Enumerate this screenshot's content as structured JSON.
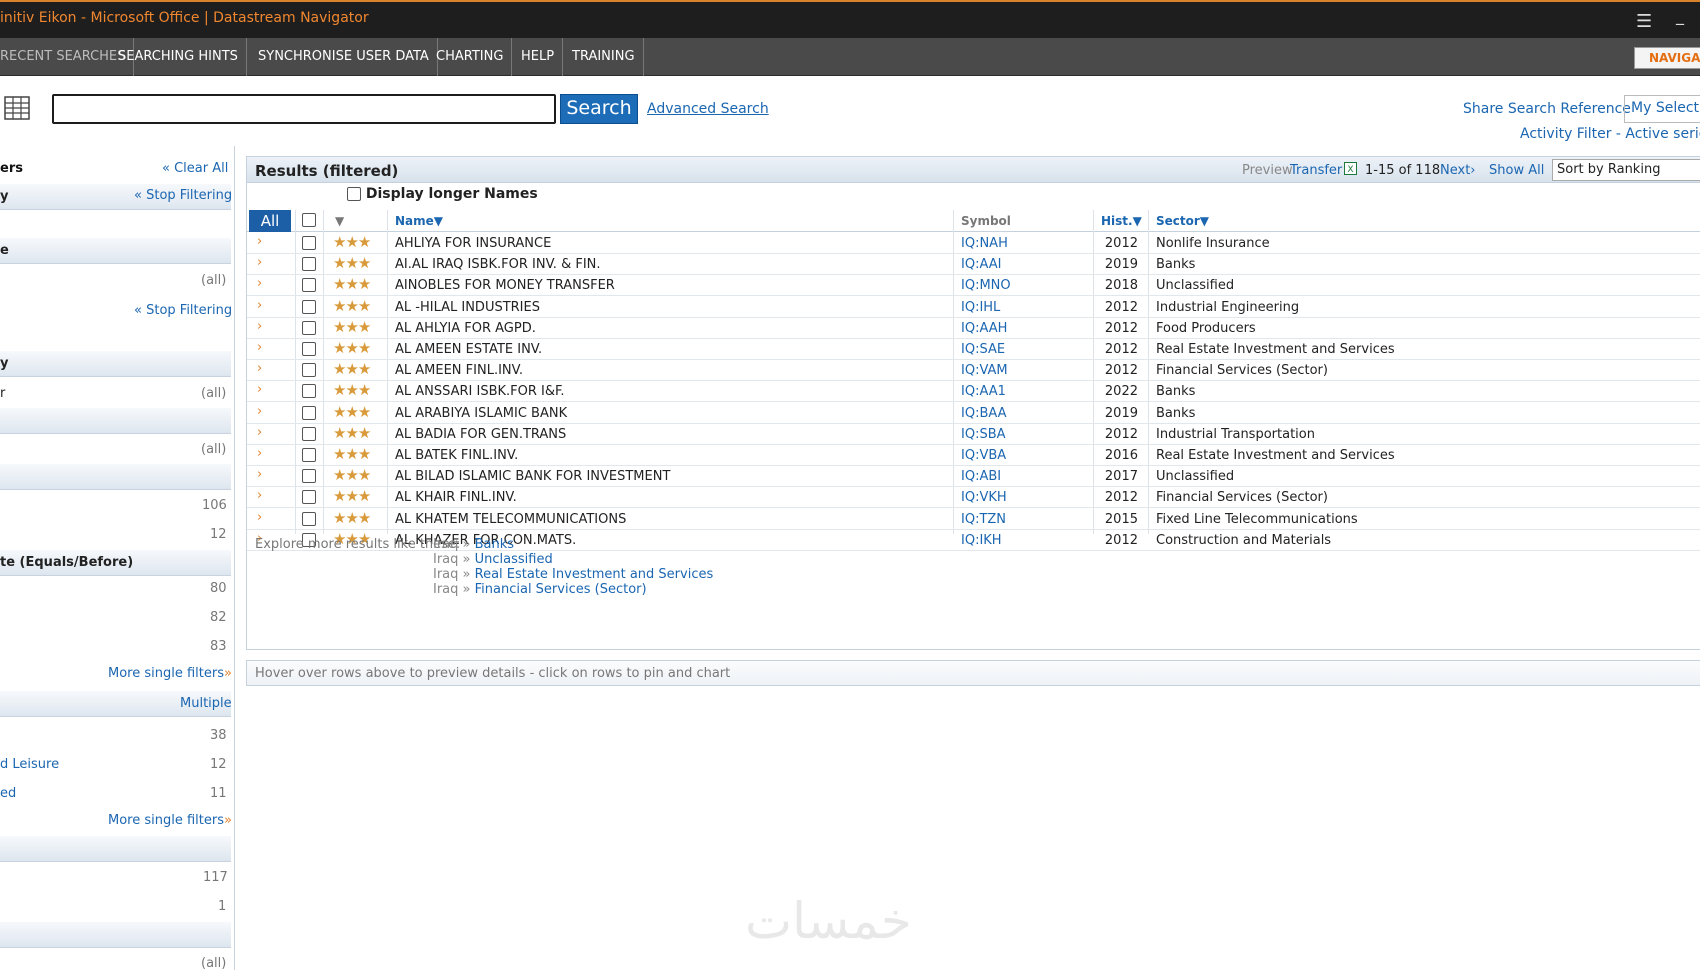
{
  "window": {
    "title": "initiv Eikon - Microsoft Office | Datastream Navigator"
  },
  "menu": {
    "items": [
      "RECENT SEARCHES",
      "SEARCHING HINTS",
      "SYNCHRONISE USER DATA",
      "CHARTING",
      "HELP",
      "TRAINING"
    ],
    "nav_button": "NAVIGA"
  },
  "search": {
    "button": "Search",
    "advanced": "Advanced Search",
    "share": "Share Search Reference",
    "my_selection": "My Selectio",
    "activity_filter": "Activity Filter - Active series c"
  },
  "left": {
    "filters_title": "ers",
    "clear_all": "Clear All",
    "h1": "y",
    "stop_filtering": "Stop Filtering",
    "h2": "e",
    "all": "(all)",
    "h3": "y",
    "r_label": "r",
    "date_title": "te (Equals/Before)",
    "n106": "106",
    "n12a": "12",
    "n80": "80",
    "n82": "82",
    "n83": "83",
    "more_single": "More single filters",
    "multiple": "Multiple",
    "n38": "38",
    "leisure": "d Leisure",
    "n12b": "12",
    "ed": "ed",
    "n11": "11",
    "n117": "117",
    "n1": "1"
  },
  "results": {
    "title": "Results (filtered)",
    "preview": "Preview",
    "transfer": "Transfer",
    "count": "1-15 of 118",
    "next": "Next",
    "show_all": "Show All",
    "sort": "Sort by Ranking",
    "longer_names": "Display longer Names",
    "all_btn": "All",
    "col_name": "Name▼",
    "col_symbol": "Symbol",
    "col_hist": "Hist.▼",
    "col_sector": "Sector▼",
    "rows": [
      {
        "name": "AHLIYA FOR INSURANCE",
        "symbol": "IQ:NAH",
        "hist": "2012",
        "sector": "Nonlife Insurance"
      },
      {
        "name": "AI.AL IRAQ ISBK.FOR INV. & FIN.",
        "symbol": "IQ:AAI",
        "hist": "2019",
        "sector": "Banks"
      },
      {
        "name": "AINOBLES FOR MONEY TRANSFER",
        "symbol": "IQ:MNO",
        "hist": "2018",
        "sector": "Unclassified"
      },
      {
        "name": "AL -HILAL INDUSTRIES",
        "symbol": "IQ:IHL",
        "hist": "2012",
        "sector": "Industrial Engineering"
      },
      {
        "name": "AL AHLYIA FOR AGPD.",
        "symbol": "IQ:AAH",
        "hist": "2012",
        "sector": "Food Producers"
      },
      {
        "name": "AL AMEEN ESTATE INV.",
        "symbol": "IQ:SAE",
        "hist": "2012",
        "sector": "Real Estate Investment and Services"
      },
      {
        "name": "AL AMEEN FINL.INV.",
        "symbol": "IQ:VAM",
        "hist": "2012",
        "sector": "Financial Services (Sector)"
      },
      {
        "name": "AL ANSSARI ISBK.FOR I&F.",
        "symbol": "IQ:AA1",
        "hist": "2022",
        "sector": "Banks"
      },
      {
        "name": "AL ARABIYA ISLAMIC BANK",
        "symbol": "IQ:BAA",
        "hist": "2019",
        "sector": "Banks"
      },
      {
        "name": "AL BADIA FOR GEN.TRANS",
        "symbol": "IQ:SBA",
        "hist": "2012",
        "sector": "Industrial Transportation"
      },
      {
        "name": "AL BATEK FINL.INV.",
        "symbol": "IQ:VBA",
        "hist": "2016",
        "sector": "Real Estate Investment and Services"
      },
      {
        "name": "AL BILAD ISLAMIC BANK FOR INVESTMENT",
        "symbol": "IQ:ABI",
        "hist": "2017",
        "sector": "Unclassified"
      },
      {
        "name": "AL KHAIR FINL.INV.",
        "symbol": "IQ:VKH",
        "hist": "2012",
        "sector": "Financial Services (Sector)"
      },
      {
        "name": "AL KHATEM TELECOMMUNICATIONS",
        "symbol": "IQ:TZN",
        "hist": "2015",
        "sector": "Fixed Line Telecommunications"
      },
      {
        "name": "AL KHAZER FOR CON.MATS.",
        "symbol": "IQ:IKH",
        "hist": "2012",
        "sector": "Construction and Materials"
      }
    ],
    "explore_label": "Explore more results like these:",
    "explore_country": "Iraq",
    "explore": [
      "Banks",
      "Unclassified",
      "Real Estate Investment and Services",
      "Financial Services (Sector)"
    ],
    "hover_hint": "Hover over rows above to preview details - click on rows to pin and chart"
  },
  "watermark": "خمسات"
}
